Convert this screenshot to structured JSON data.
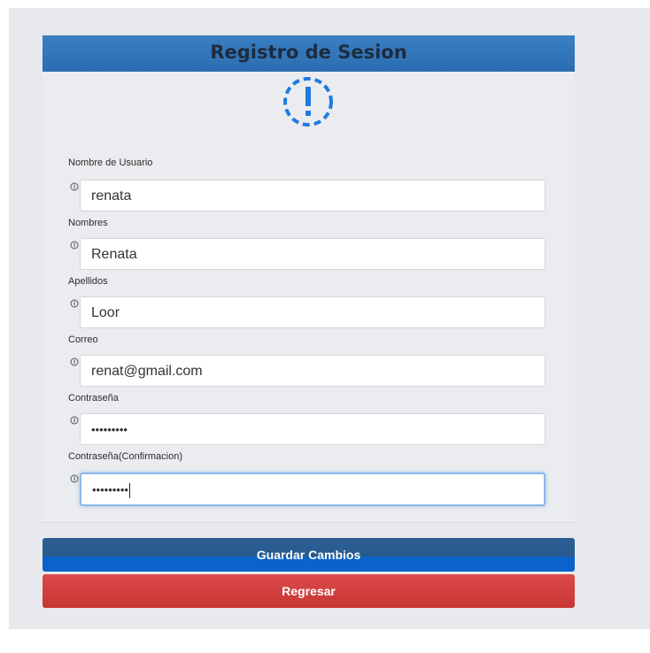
{
  "form": {
    "title": "Registro de Sesion",
    "fields": [
      {
        "label": "Nombre de Usuario",
        "value": "renata"
      },
      {
        "label": "Nombres",
        "value": "Renata"
      },
      {
        "label": "Apellidos",
        "value": "Loor"
      },
      {
        "label": "Correo",
        "value": "renat@gmail.com"
      },
      {
        "label": "Contraseña",
        "value": "•••••••••"
      },
      {
        "label": "Contraseña(Confirmacion)",
        "value": "•••••••••"
      }
    ]
  },
  "buttons": {
    "save_label": "Guardar Cambios",
    "back_label": "Regresar"
  },
  "colors": {
    "header": "#2a6db0",
    "save": "#0b63cc",
    "back": "#c63633",
    "alert_icon": "#1f7ae0"
  },
  "icons": {
    "alert": "exclamation-circle-dashed-icon",
    "field_hint": "info-circle-icon"
  }
}
